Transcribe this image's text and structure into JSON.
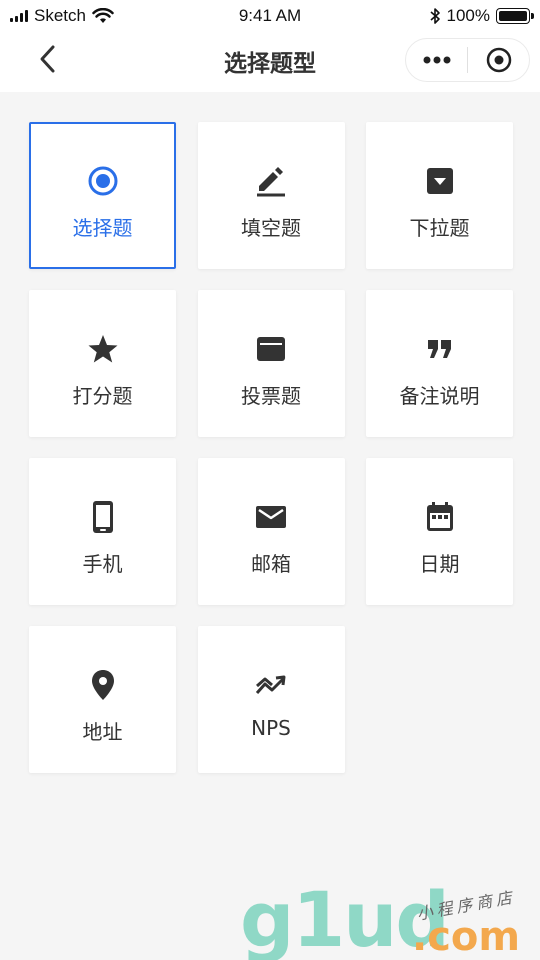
{
  "status_bar": {
    "carrier": "Sketch",
    "time": "9:41 AM",
    "battery": "100%"
  },
  "nav": {
    "title": "选择题型"
  },
  "question_types": [
    {
      "label": "选择题",
      "icon": "radio-icon",
      "selected": true
    },
    {
      "label": "填空题",
      "icon": "pencil-icon",
      "selected": false
    },
    {
      "label": "下拉题",
      "icon": "dropdown-icon",
      "selected": false
    },
    {
      "label": "打分题",
      "icon": "star-icon",
      "selected": false
    },
    {
      "label": "投票题",
      "icon": "ballot-box-icon",
      "selected": false
    },
    {
      "label": "备注说明",
      "icon": "quote-icon",
      "selected": false
    },
    {
      "label": "手机",
      "icon": "phone-icon",
      "selected": false
    },
    {
      "label": "邮箱",
      "icon": "mail-icon",
      "selected": false
    },
    {
      "label": "日期",
      "icon": "calendar-icon",
      "selected": false
    },
    {
      "label": "地址",
      "icon": "location-pin-icon",
      "selected": false
    },
    {
      "label": "NPS",
      "icon": "trend-icon",
      "selected": false
    }
  ],
  "colors": {
    "accent": "#2a6fe8",
    "icon": "#333333",
    "background": "#f5f5f5"
  },
  "watermark": {
    "brand": "g1ud",
    "domain": ".com",
    "tagline": "小程序商店"
  }
}
